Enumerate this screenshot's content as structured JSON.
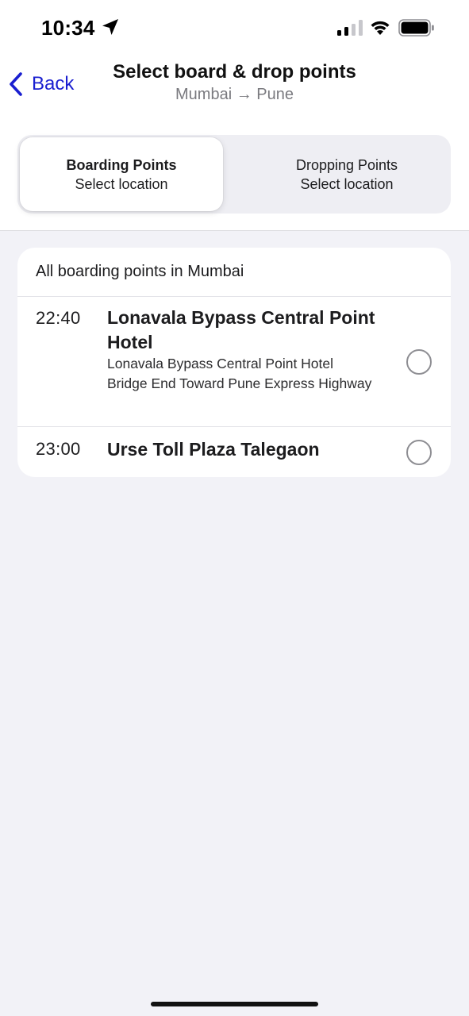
{
  "status_bar": {
    "time": "10:34"
  },
  "nav": {
    "back_label": "Back",
    "title": "Select board & drop points",
    "subtitle": "Mumbai → Pune"
  },
  "segments": [
    {
      "title": "Boarding Points",
      "subtitle": "Select location",
      "selected": true
    },
    {
      "title": "Dropping Points",
      "subtitle": "Select location",
      "selected": false
    }
  ],
  "boarding_list": {
    "header": "All boarding points in Mumbai",
    "points": [
      {
        "time": "22:40",
        "name": "Lonavala Bypass Central Point Hotel",
        "address": "Lonavala Bypass Central Point Hotel Bridge End Toward Pune Express Highway",
        "selected": false
      },
      {
        "time": "23:00",
        "name": "Urse Toll Plaza Talegaon",
        "address": "",
        "selected": false
      }
    ]
  },
  "colors": {
    "accent": "#1a1fd0",
    "background": "#f2f2f7",
    "card": "#ffffff",
    "secondary_text": "#7a7a7f"
  },
  "icons": {
    "status": [
      "location-arrow-icon",
      "signal-icon",
      "wifi-icon",
      "battery-icon"
    ],
    "back": "chevron-left-icon",
    "radio": "radio-unselected-icon"
  }
}
